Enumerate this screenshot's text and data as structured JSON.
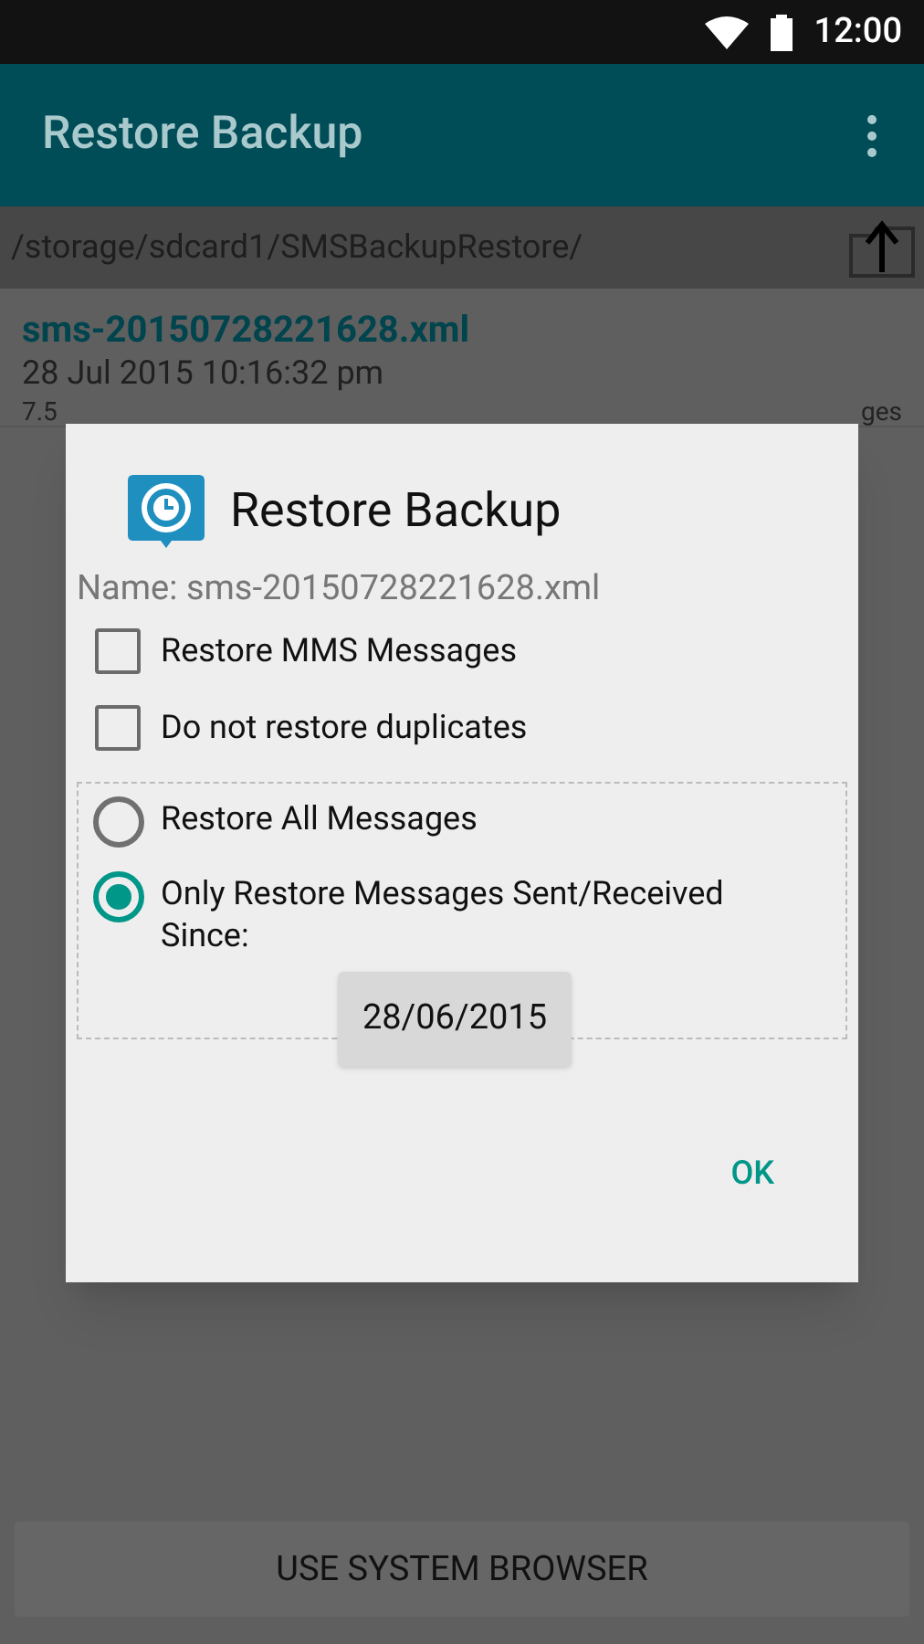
{
  "status_bar": {
    "time": "12:00"
  },
  "app_bar": {
    "title": "Restore Backup"
  },
  "path_bar": {
    "path": "/storage/sdcard1/SMSBackupRestore/"
  },
  "files": [
    {
      "name": "sms-20150728221628.xml",
      "date": "28 Jul 2015 10:16:32 pm",
      "size": "7.5",
      "count": "ges"
    }
  ],
  "dialog": {
    "title": "Restore Backup",
    "name_line": "Name: sms-20150728221628.xml",
    "checkboxes": [
      {
        "label": "Restore MMS Messages",
        "checked": false
      },
      {
        "label": "Do not restore duplicates",
        "checked": false
      }
    ],
    "radios": [
      {
        "label": "Restore All Messages",
        "selected": false
      },
      {
        "label": "Only Restore Messages Sent/Received Since:",
        "selected": true
      }
    ],
    "date_button": "28/06/2015",
    "ok_button": "OK"
  },
  "bottom_button": "USE SYSTEM BROWSER"
}
